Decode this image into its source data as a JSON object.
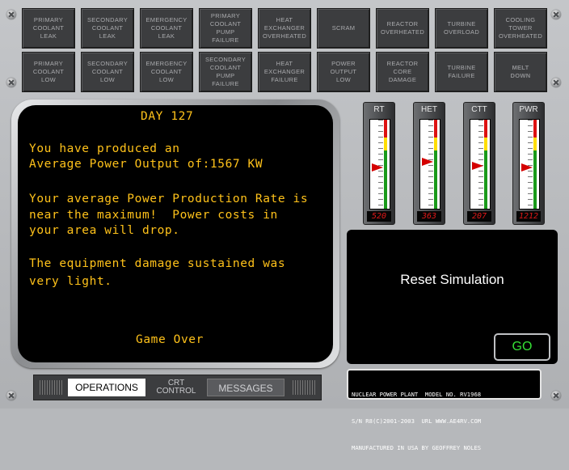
{
  "alarms_row1": [
    "Primary\nCoolant\nLeak",
    "Secondary\nCoolant\nLeak",
    "Emergency\nCoolant\nLeak",
    "Primary\nCoolant\nPump\nFailure",
    "Heat\nExchanger\nOverheated",
    "Scram",
    "Reactor\nOverheated",
    "Turbine\nOverload",
    "Cooling\nTower\nOverheated"
  ],
  "alarms_row2": [
    "Primary\nCoolant\nLow",
    "Secondary\nCoolant\nLow",
    "Emergency\nCoolant\nLow",
    "Secondary\nCoolant\nPump\nFailure",
    "Heat\nExchanger\nFailure",
    "Power\nOutput\nLow",
    "Reactor\nCore\nDamage",
    "Turbine\nFailure",
    "Melt\nDown"
  ],
  "crt": {
    "day": "DAY 127",
    "line1": "You have produced an",
    "line2": "Average Power Output of:1567 KW",
    "line3": "Your average Power Production Rate is",
    "line4": "near the maximum!  Power costs in",
    "line5": "your area will drop.",
    "line6": "The equipment damage sustained was",
    "line7": "very light.",
    "status": "Game Over"
  },
  "gauges": [
    {
      "label": "RT",
      "readout": "520",
      "level": 0.46
    },
    {
      "label": "HET",
      "readout": "363",
      "level": 0.53
    },
    {
      "label": "CTT",
      "readout": "207",
      "level": 0.48
    },
    {
      "label": "PWR",
      "readout": "1212",
      "level": 0.46
    }
  ],
  "control": {
    "reset_label": "Reset Simulation",
    "go_label": "GO"
  },
  "tabs": {
    "operations": "OPERATIONS",
    "crt_control": "CRT\nCONTROL",
    "messages": "MESSAGES"
  },
  "nameplate": {
    "line1": "NUCLEAR POWER PLANT  MODEL NO. RV1968",
    "line2": "S/N R8(C)2001-2003  URL WWW.AE4RV.COM",
    "line3": "MANUFACTURED IN USA BY GEOFFREY NOLES"
  },
  "colors": {
    "crt_text": "#ffc21a",
    "gauge_red": "#d11111",
    "gauge_yellow": "#ffde00",
    "gauge_green": "#1a9a1a",
    "go_text": "#35e035"
  }
}
